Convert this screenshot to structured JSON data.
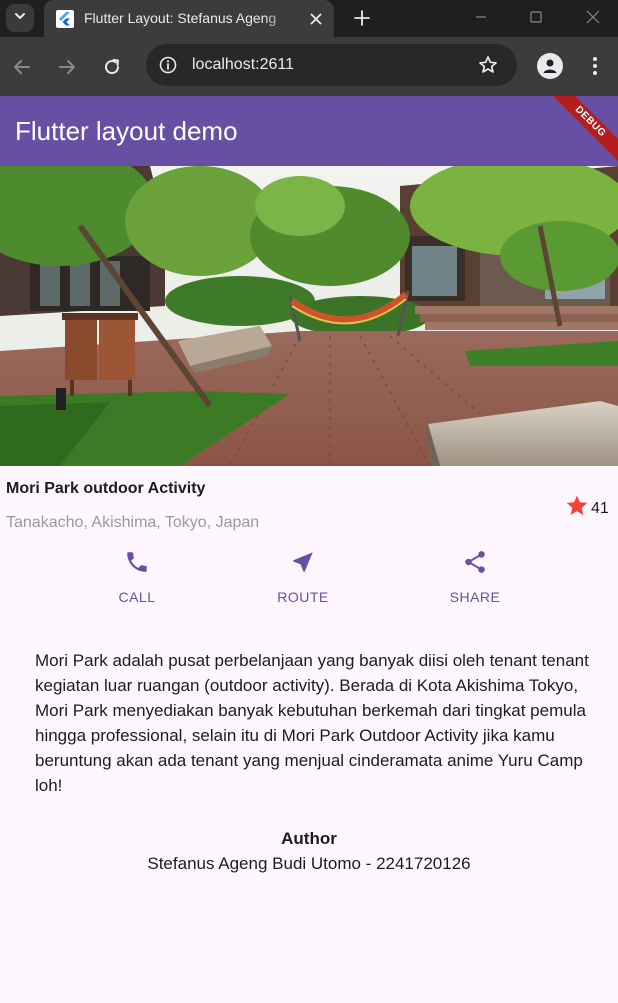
{
  "browser": {
    "tab_title": "Flutter Layout: Stefanus Ageng",
    "url": "localhost:2611"
  },
  "app": {
    "title": "Flutter layout demo",
    "debug_label": "DEBUG",
    "header_color": "#6750a4"
  },
  "place": {
    "title": "Mori Park outdoor Activity",
    "subtitle": "Tanakacho, Akishima, Tokyo, Japan",
    "rating_count": "41",
    "rating_icon": "star-icon",
    "rating_color": "#f44336"
  },
  "actions": [
    {
      "label": "CALL",
      "icon": "phone-icon"
    },
    {
      "label": "ROUTE",
      "icon": "near-me-icon"
    },
    {
      "label": "SHARE",
      "icon": "share-icon"
    }
  ],
  "description": "Mori Park adalah pusat perbelanjaan yang banyak diisi oleh tenant tenant kegiatan luar ruangan (outdoor activity). Berada di Kota Akishima Tokyo, Mori Park menyediakan banyak kebutuhan berkemah dari tingkat pemula hingga professional, selain itu di Mori Park Outdoor Activity jika kamu beruntung akan ada tenant yang menjual cinderamata anime Yuru Camp loh!",
  "author": {
    "heading": "Author",
    "name": "Stefanus Ageng Budi Utomo - 2241720126"
  }
}
